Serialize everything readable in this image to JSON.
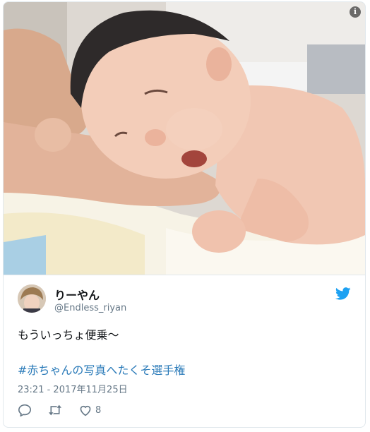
{
  "tweet": {
    "display_name": "りーやん",
    "handle": "@Endless_riyan",
    "text": "もういっちょ便乗〜",
    "hashtag": "#赤ちゃんの写真へたくそ選手権",
    "timestamp": "23:21 - 2017年11月25日",
    "like_count": "8"
  },
  "icons": {
    "info": "info-icon",
    "bird": "twitter-bird-icon",
    "reply": "reply-icon",
    "retweet": "retweet-icon",
    "like": "heart-icon"
  },
  "colors": {
    "twitter_blue": "#1da1f2",
    "hashtag": "#2b7bb9",
    "muted": "#657786",
    "text": "#14171a"
  }
}
